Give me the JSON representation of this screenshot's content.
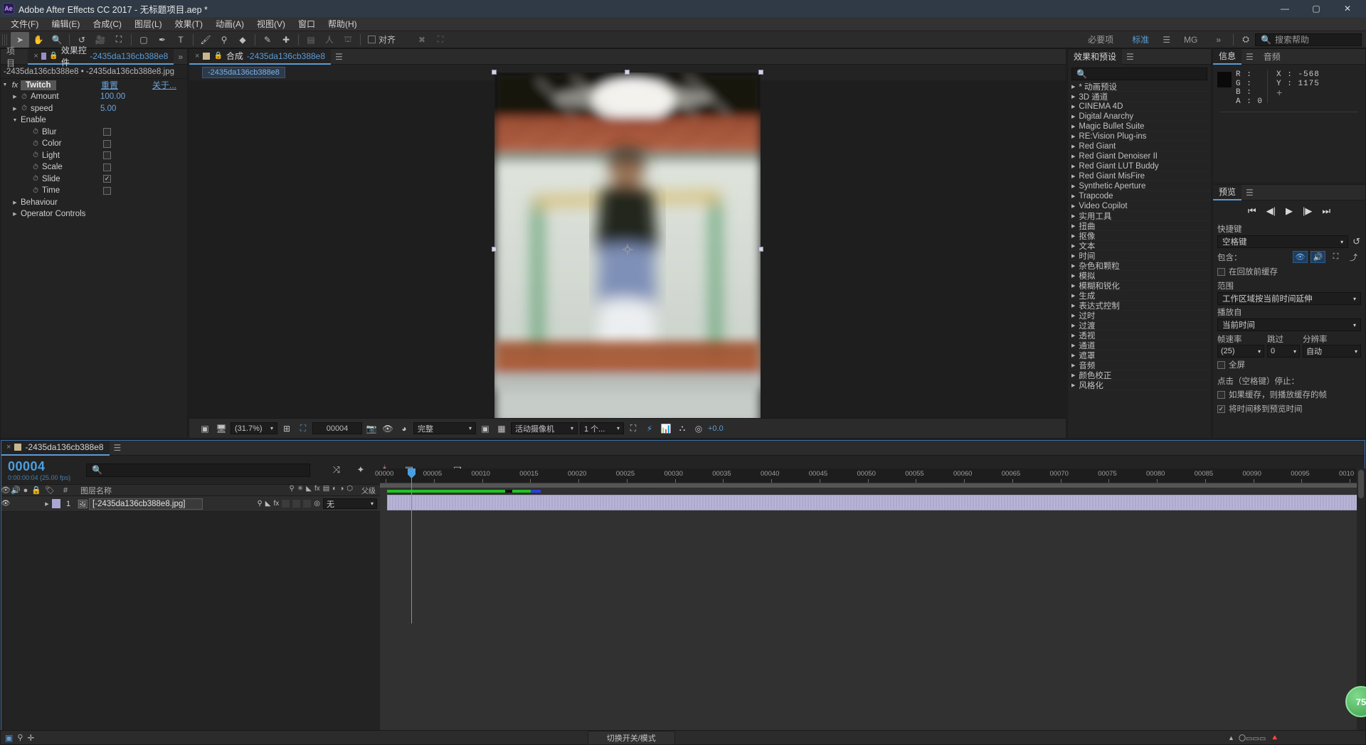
{
  "window": {
    "app_icon": "Ae",
    "title": "Adobe After Effects CC 2017 - 无标题项目.aep *",
    "minimize": "—",
    "maximize": "▢",
    "close": "✕"
  },
  "menubar": {
    "items": [
      "文件(F)",
      "编辑(E)",
      "合成(C)",
      "图层(L)",
      "效果(T)",
      "动画(A)",
      "视图(V)",
      "窗口",
      "帮助(H)"
    ]
  },
  "toolbar": {
    "tools": [
      {
        "name": "selection-tool",
        "glyph": "➤",
        "active": true
      },
      {
        "name": "hand-tool",
        "glyph": "✋",
        "active": false
      },
      {
        "name": "zoom-tool",
        "glyph": "🔍",
        "active": false
      },
      {
        "name": "rotation-tool",
        "glyph": "↺",
        "active": false
      },
      {
        "name": "camera-tool",
        "glyph": "🎥",
        "active": false
      },
      {
        "name": "pan-behind-tool",
        "glyph": "⛶",
        "active": false
      },
      {
        "name": "shape-tool",
        "glyph": "▢",
        "active": false
      },
      {
        "name": "pen-tool",
        "glyph": "✒",
        "active": false
      },
      {
        "name": "type-tool",
        "glyph": "T",
        "active": false
      },
      {
        "name": "brush-tool",
        "glyph": "🖌",
        "active": false
      },
      {
        "name": "clone-stamp-tool",
        "glyph": "⚲",
        "active": false
      },
      {
        "name": "eraser-tool",
        "glyph": "◆",
        "active": false
      },
      {
        "name": "roto-brush-tool",
        "glyph": "✎",
        "active": false
      },
      {
        "name": "puppet-pin-tool",
        "glyph": "✚",
        "active": false
      }
    ],
    "snapping_label": "对齐",
    "snapping_checked": false,
    "workspaces": [
      "必要项",
      "标准",
      "MG"
    ],
    "workspace_selected": "标准",
    "overflow": "»",
    "search_placeholder": "搜索帮助"
  },
  "effect_controls": {
    "tabs": [
      {
        "label": "项目",
        "active": false,
        "closable": false
      },
      {
        "label": "效果控件",
        "name_suffix": "-2435da136cb388e8",
        "active": true,
        "closable": true
      }
    ],
    "overflow": "»",
    "breadcrumb": "-2435da136cb388e8 • -2435da136cb388e8.jpg",
    "effect_name": "Twitch",
    "reset_label": "重置",
    "about_label": "关于...",
    "properties": [
      {
        "name": "Amount",
        "value": "100.00",
        "type": "value",
        "indent": 1
      },
      {
        "name": "speed",
        "value": "5.00",
        "type": "value",
        "indent": 1
      },
      {
        "name": "Enable",
        "value": "",
        "type": "group-open",
        "indent": 1
      },
      {
        "name": "Blur",
        "checked": false,
        "type": "checkbox",
        "indent": 2
      },
      {
        "name": "Color",
        "checked": false,
        "type": "checkbox",
        "indent": 2
      },
      {
        "name": "Light",
        "checked": false,
        "type": "checkbox",
        "indent": 2
      },
      {
        "name": "Scale",
        "checked": false,
        "type": "checkbox",
        "indent": 2
      },
      {
        "name": "Slide",
        "checked": true,
        "type": "checkbox",
        "indent": 2
      },
      {
        "name": "Time",
        "checked": false,
        "type": "checkbox",
        "indent": 2
      },
      {
        "name": "Behaviour",
        "value": "",
        "type": "group-closed",
        "indent": 1
      },
      {
        "name": "Operator Controls",
        "value": "",
        "type": "group-closed",
        "indent": 1
      }
    ]
  },
  "composition": {
    "tab_label": "合成",
    "comp_name": "-2435da136cb388e8",
    "breadcrumb_chip": "-2435da136cb388e8",
    "bottom_bar": {
      "zoom": "(31.7%)",
      "frame": "00004",
      "quality": "完整",
      "camera": "活动摄像机",
      "views": "1 个...",
      "exposure": "+0.0"
    }
  },
  "effects_presets": {
    "title": "效果和预设",
    "search_placeholder": "",
    "items": [
      "* 动画预设",
      "3D 通道",
      "CINEMA 4D",
      "Digital Anarchy",
      "Magic Bullet Suite",
      "RE:Vision Plug-ins",
      "Red Giant",
      "Red Giant Denoiser II",
      "Red Giant LUT Buddy",
      "Red Giant MisFire",
      "Synthetic Aperture",
      "Trapcode",
      "Video Copilot",
      "实用工具",
      "扭曲",
      "抠像",
      "文本",
      "时间",
      "杂色和颗粒",
      "模拟",
      "模糊和锐化",
      "生成",
      "表达式控制",
      "过时",
      "过渡",
      "透视",
      "通道",
      "遮罩",
      "音频",
      "颜色校正",
      "风格化"
    ]
  },
  "info": {
    "tabs": [
      "信息",
      "音频"
    ],
    "active_tab": "信息",
    "channels": [
      {
        "label": "R :",
        "value": ""
      },
      {
        "label": "G :",
        "value": ""
      },
      {
        "label": "B :",
        "value": ""
      },
      {
        "label": "A :",
        "value": "0"
      }
    ],
    "coords": [
      {
        "label": "X :",
        "value": "-568"
      },
      {
        "label": "Y :",
        "value": "1175"
      }
    ]
  },
  "preview": {
    "title": "预览",
    "transport": [
      "⏮",
      "◀|",
      "▶",
      "|▶",
      "⏭"
    ],
    "shortcut_label": "快捷键",
    "shortcut_value": "空格键",
    "include_label": "包含：",
    "include_icons": [
      "eye-icon",
      "speaker-icon",
      "frame-icon",
      "export-icon"
    ],
    "cache_before_playback_label": "在回放前缓存",
    "cache_before_playback_checked": false,
    "range_label": "范围",
    "range_value": "工作区域按当前时间延伸",
    "play_from_label": "播放自",
    "play_from_value": "当前时间",
    "frame_rate_label": "帧速率",
    "frame_rate_value": "(25)",
    "skip_label": "跳过",
    "skip_value": "0",
    "resolution_label": "分辨率",
    "resolution_value": "自动",
    "fullscreen_label": "全屏",
    "fullscreen_checked": false,
    "on_stop_label": "点击（空格键）停止：",
    "option_cached_label": "如果缓存，则播放缓存的帧",
    "option_cached_checked": false,
    "option_move_time_label": "将时间移到预览时间",
    "option_move_time_checked": true
  },
  "timeline": {
    "tab_label": "-2435da136cb388e8",
    "current_time": "00004",
    "current_time_sub": "0:00:00:04 (25.00 fps)",
    "search_placeholder": "",
    "columns": [
      "#",
      "图层名称",
      "父级"
    ],
    "layers": [
      {
        "index": "1",
        "name": "[-2435da136cb388e8.jpg]",
        "parent": "无",
        "visible": true
      }
    ],
    "ruler_ticks": [
      "00000",
      "00005",
      "00010",
      "00015",
      "00020",
      "00025",
      "00030",
      "00035",
      "00040",
      "00045",
      "00050",
      "00055",
      "00060",
      "00065",
      "00070",
      "00075",
      "00080",
      "00085",
      "00090",
      "00095",
      "0010"
    ],
    "toggle_switches_label": "切换开关/模式",
    "badge_value": "75"
  },
  "colors": {
    "accent_blue": "#4b9fe0",
    "panel_bg": "#232323",
    "tab_bg": "#2b2b2b",
    "titlebar_bg": "#2f3a46",
    "green_bar": "#22c322"
  }
}
